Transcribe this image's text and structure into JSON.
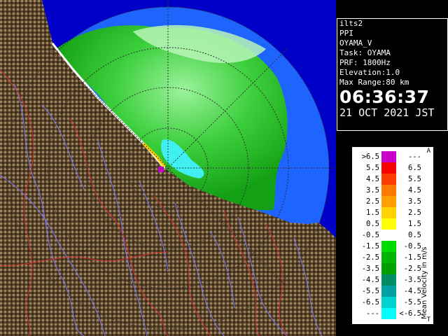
{
  "info_panel": {
    "line1": "ilts2",
    "line2": "PPI",
    "line3": "OYAMA_V",
    "task": "Task: OYAMA",
    "prf": "PRF: 1800Hz",
    "elevation": "Elevation:1.0",
    "max_range": "Max Range:80 km",
    "time": "06:36:37",
    "date": "21 OCT 2021 JST"
  },
  "legend": {
    "title": "Mean Velocity in m/s",
    "corner_top": "A",
    "corner_bottom": "T",
    "rows": [
      {
        "lo": ">6.5",
        "hi": "---",
        "color": "#c800c8"
      },
      {
        "lo": "5.5",
        "hi": "6.5",
        "color": "#ff0000"
      },
      {
        "lo": "4.5",
        "hi": "5.5",
        "color": "#ff3c00"
      },
      {
        "lo": "3.5",
        "hi": "4.5",
        "color": "#ff7800"
      },
      {
        "lo": "2.5",
        "hi": "3.5",
        "color": "#ffa000"
      },
      {
        "lo": "1.5",
        "hi": "2.5",
        "color": "#ffd200"
      },
      {
        "lo": "0.5",
        "hi": "1.5",
        "color": "#ffff00"
      },
      {
        "lo": "-0.5",
        "hi": "0.5",
        "color": "#ffffff"
      },
      {
        "lo": "-1.5",
        "hi": "-0.5",
        "color": "#00dc00"
      },
      {
        "lo": "-2.5",
        "hi": "-1.5",
        "color": "#00b400"
      },
      {
        "lo": "-3.5",
        "hi": "-2.5",
        "color": "#00a000"
      },
      {
        "lo": "-4.5",
        "hi": "-3.5",
        "color": "#008c64"
      },
      {
        "lo": "-5.5",
        "hi": "-4.5",
        "color": "#00a0a0"
      },
      {
        "lo": "-6.5",
        "hi": "-5.5",
        "color": "#00d2d2"
      },
      {
        "lo": "---",
        "hi": "<-6.5",
        "color": "#00ffff"
      }
    ]
  },
  "colors": {
    "background": "#000000",
    "sea": "#0000c8",
    "radar_range_fill": "#1e64ff",
    "terrain_dark": "#4b3a22",
    "terrain_light": "#a8926a",
    "river": "#7a7aff",
    "boundary": "#d83030",
    "range_ring": "#202020"
  }
}
